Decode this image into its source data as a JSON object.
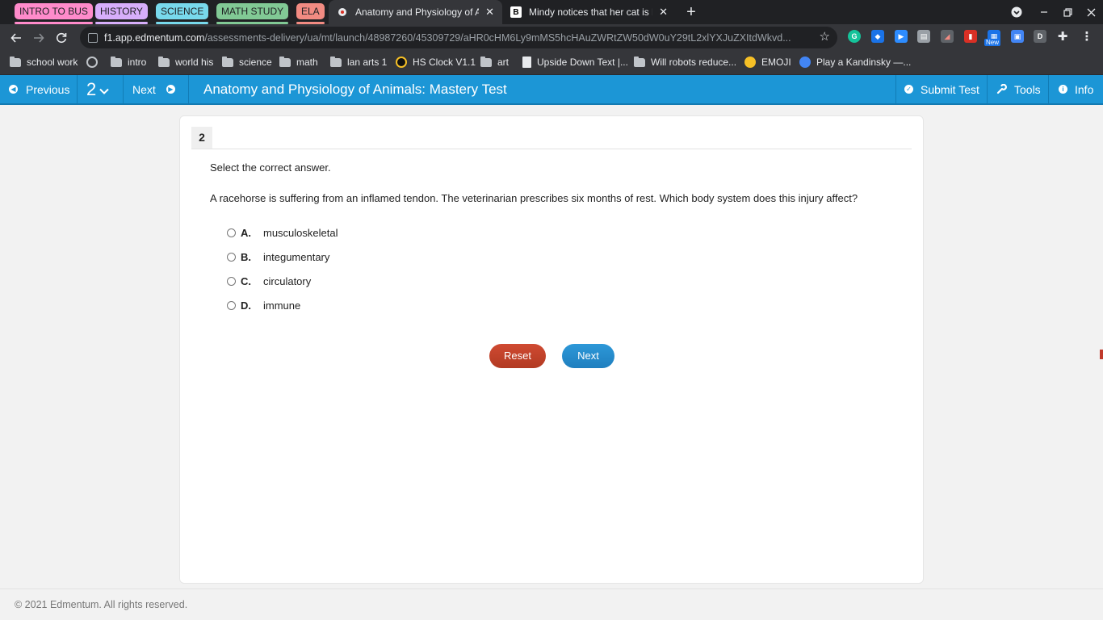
{
  "browser": {
    "tab_groups": [
      {
        "label": "INTRO TO BUS",
        "color": "#ff8bcb"
      },
      {
        "label": "HISTORY",
        "color": "#d7aefb"
      },
      {
        "label": "SCIENCE",
        "color": "#78d9ec"
      },
      {
        "label": "MATH STUDY",
        "color": "#81c995"
      },
      {
        "label": "ELA",
        "color": "#f28b82"
      }
    ],
    "tabs": [
      {
        "title": "Anatomy and Physiology of Animals: Mastery Test",
        "active": true
      },
      {
        "title": "Mindy notices that her cat is having trouble",
        "active": false,
        "favicon": "B"
      }
    ],
    "url_host": "f1.app.edmentum.com",
    "url_path": "/assessments-delivery/ua/mt/launch/48987260/45309729/aHR0cHM6Ly9mMS5hcHAuZWRtZW50dW0uY29tL2xlYXJuZXItdWkvd...",
    "extension_badge": "New",
    "extension_letter": "D",
    "bookmarks": [
      {
        "label": "school work",
        "type": "folder"
      },
      {
        "label": "",
        "type": "globe"
      },
      {
        "label": "intro",
        "type": "folder"
      },
      {
        "label": "world his",
        "type": "folder"
      },
      {
        "label": "science",
        "type": "folder"
      },
      {
        "label": "math",
        "type": "folder"
      },
      {
        "label": "lan arts 1",
        "type": "folder"
      },
      {
        "label": "HS Clock V1.1",
        "type": "site"
      },
      {
        "label": "art",
        "type": "folder"
      },
      {
        "label": "Upside Down Text |...",
        "type": "page"
      },
      {
        "label": "Will robots reduce...",
        "type": "folder"
      },
      {
        "label": "EMOJI",
        "type": "emoji"
      },
      {
        "label": "Play a Kandinsky —...",
        "type": "site"
      }
    ]
  },
  "header": {
    "previous_label": "Previous",
    "question_selector": "2",
    "next_label": "Next",
    "test_title": "Anatomy and Physiology of Animals: Mastery Test",
    "submit_label": "Submit Test",
    "tools_label": "Tools",
    "info_label": "Info",
    "accent": "#1c96d6"
  },
  "question": {
    "number": "2",
    "instruction": "Select the correct answer.",
    "stem": "A racehorse is suffering from an inflamed tendon. The veterinarian prescribes six months of rest. Which body system does this injury affect?",
    "choices": [
      {
        "letter": "A.",
        "text": "musculoskeletal"
      },
      {
        "letter": "B.",
        "text": "integumentary"
      },
      {
        "letter": "C.",
        "text": "circulatory"
      },
      {
        "letter": "D.",
        "text": "immune"
      }
    ],
    "reset_label": "Reset",
    "next_label": "Next"
  },
  "footer": {
    "copyright": "© 2021 Edmentum. All rights reserved."
  }
}
